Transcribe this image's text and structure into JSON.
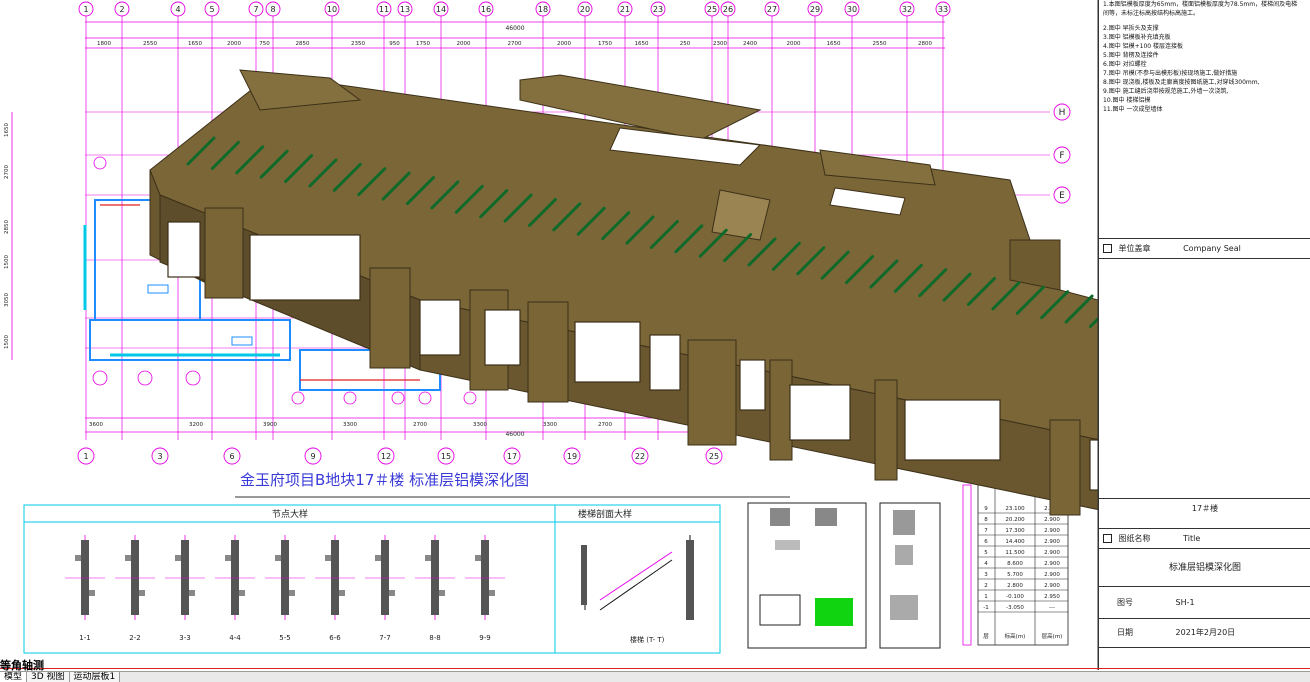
{
  "colors": {
    "gridline": "#e600e6",
    "model_body": "#7b6638",
    "model_edge": "#3c3018",
    "model_stripe": "#0f6a2a",
    "wall_blue": "#1e8cff",
    "cyan": "#00c8e6"
  },
  "plan": {
    "top_axis_labels": [
      "1",
      "2",
      "4",
      "5",
      "7",
      "8",
      "10",
      "11",
      "13",
      "14",
      "16",
      "18",
      "20",
      "21",
      "23",
      "25",
      "26",
      "27",
      "29",
      "30",
      "32",
      "33"
    ],
    "top_total_dim": "46000",
    "top_dims": [
      "1800",
      "2550",
      "1650",
      "2000",
      "750",
      "2850",
      "2350",
      "950",
      "1750",
      "2000",
      "2700",
      "2000",
      "1750",
      "1650",
      "250",
      "2300",
      "2400",
      "2000",
      "1650",
      "2550",
      "2800"
    ],
    "right_axis_labels": [
      "H",
      "F",
      "E"
    ],
    "left_dims": [
      "1650",
      "2700",
      "2850",
      "1500",
      "3050",
      "1500"
    ],
    "bottom_dims": [
      "3600",
      "3200",
      "3900",
      "3300",
      "2700",
      "3300",
      "3300",
      "2700"
    ],
    "bottom_total_dim": "46000",
    "bottom_axis_labels": [
      "1",
      "3",
      "6",
      "9",
      "12",
      "15",
      "17",
      "19",
      "22",
      "25"
    ],
    "drawing_title": "金玉府项目B地块17＃楼  标准层铝模深化图"
  },
  "details": {
    "node_title": "节点大样",
    "stair_title": "楼梯剖面大样",
    "node_labels": [
      "1-1",
      "2-2",
      "3-3",
      "4-4",
      "5-5",
      "6-6",
      "7-7",
      "8-8",
      "9-9"
    ],
    "stair_label": "楼梯 (T- T)"
  },
  "elevation_table": {
    "rows": [
      [
        "9",
        "23.100",
        "2.900"
      ],
      [
        "8",
        "20.200",
        "2.900"
      ],
      [
        "7",
        "17.300",
        "2.900"
      ],
      [
        "6",
        "14.400",
        "2.900"
      ],
      [
        "5",
        "11.500",
        "2.900"
      ],
      [
        "4",
        "8.600",
        "2.900"
      ],
      [
        "3",
        "5.700",
        "2.900"
      ],
      [
        "2",
        "2.800",
        "2.900"
      ],
      [
        "1",
        "-0.100",
        "2.950"
      ],
      [
        "-1",
        "-3.050",
        "---"
      ]
    ],
    "footer": [
      "层",
      "标高(m)",
      "层高(m)"
    ]
  },
  "title_block": {
    "notes": [
      "1.本图铝模板厚度为65mm，楼面铝模板厚度为78.5mm，楼梯间及电梯",
      "间等，未标注标高按结构标高施工。",
      "2.图中      早拆头及支撑",
      "3.图中      铝模板补充填充板",
      "4.图中      铝模+100 楼层连接板",
      "5.图中      背楞及连接件",
      "6.图中      对拉螺栓",
      "7.图中      吊模(不参与出模形板)按现场施工,做好措施",
      "8.图中      现浇板,楼板及走廊高度按图纸施工,对穿线300mm,",
      "9.图中      施工缝后浇带按规范施工,外墙一次浇筑,",
      "10.图中      楼梯铝模",
      "11.图中      一次成型墙体"
    ],
    "company_seal_cn": "单位盖章",
    "company_seal_en": "Company Seal",
    "building": "17＃楼",
    "drawing_name_cn": "图纸名称",
    "drawing_name_en": "Title",
    "drawing_name": "标准层铝模深化图",
    "drawing_no_label": "图号",
    "drawing_no": "SH-1",
    "date_label": "日期",
    "date": "2021年2月20日"
  },
  "status": {
    "view_title": "等角轴测",
    "tabs": [
      "模型",
      "3D 视图",
      "运动层板1"
    ]
  }
}
